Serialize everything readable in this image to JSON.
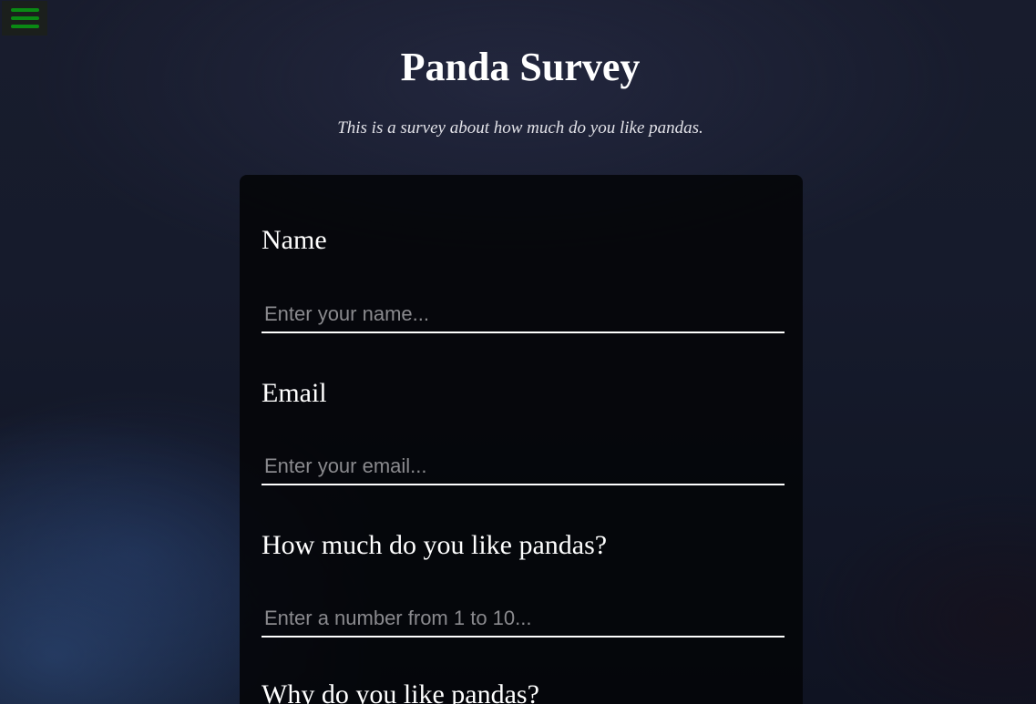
{
  "menu": {
    "icon": "hamburger-menu-icon",
    "accent_color": "#0a8a14"
  },
  "header": {
    "title": "Panda Survey",
    "description": "This is a survey about how much do you like pandas."
  },
  "form": {
    "fields": [
      {
        "label": "Name",
        "placeholder": "Enter your name...",
        "value": ""
      },
      {
        "label": "Email",
        "placeholder": "Enter your email...",
        "value": ""
      },
      {
        "label": "How much do you like pandas?",
        "placeholder": "Enter a number from 1 to 10...",
        "value": ""
      },
      {
        "label": "Why do you like pandas?"
      }
    ]
  }
}
